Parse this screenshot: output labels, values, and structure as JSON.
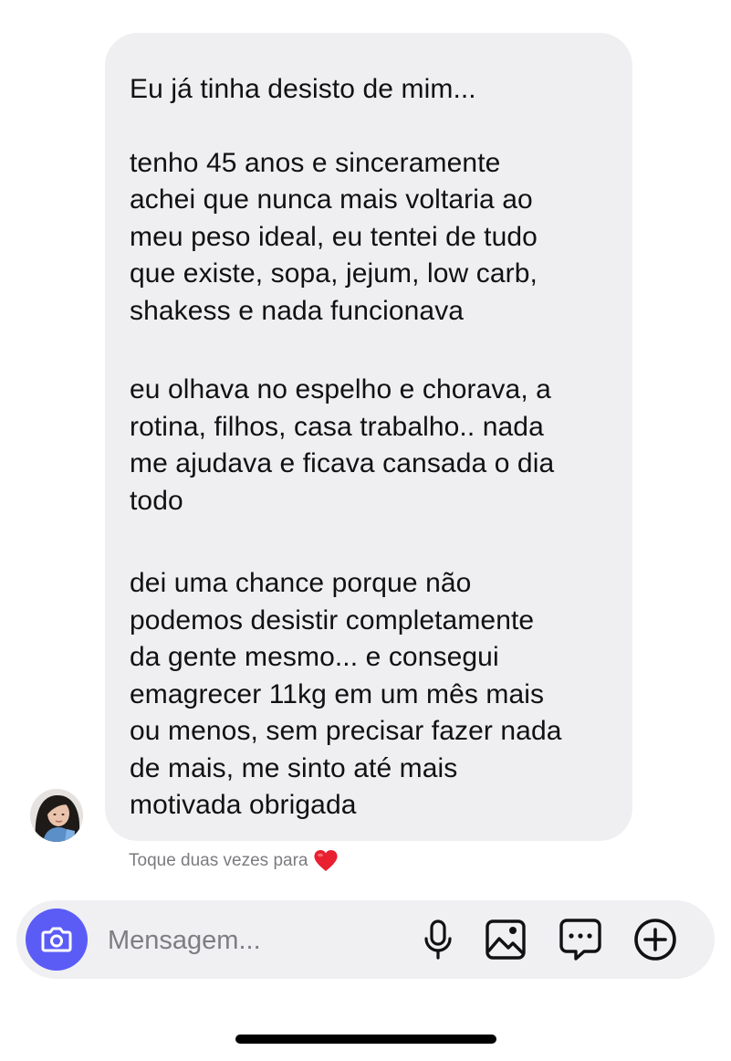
{
  "message": {
    "paragraphs": [
      [
        "Eu já tinha desisto de mim..."
      ],
      [
        "tenho 45 anos e sinceramente",
        "achei que nunca mais voltaria ao",
        "meu peso ideal, eu tentei de tudo",
        "que existe, sopa, jejum, low carb,",
        "shakess e nada funcionava"
      ],
      [
        "eu olhava no espelho e chorava, a",
        "rotina, filhos, casa trabalho.. nada",
        "me ajudava e ficava cansada o dia",
        "todo"
      ],
      [
        "dei uma chance porque não",
        "podemos desistir completamente",
        "da gente mesmo... e consegui",
        "emagrecer 11kg em um mês mais",
        "ou menos, sem precisar fazer nada",
        "de mais, me sinto até mais",
        "motivada obrigada"
      ]
    ],
    "bubble_color": "#efeff2"
  },
  "hint": {
    "text": "Toque duas vezes para",
    "icon": "heart-icon"
  },
  "composer": {
    "placeholder": "Mensagem...",
    "value": "",
    "camera_icon": "camera-icon",
    "camera_color": "#5b5cf6",
    "tools": [
      "microphone-icon",
      "gallery-icon",
      "sticker-chat-icon",
      "plus-circle-icon"
    ]
  }
}
